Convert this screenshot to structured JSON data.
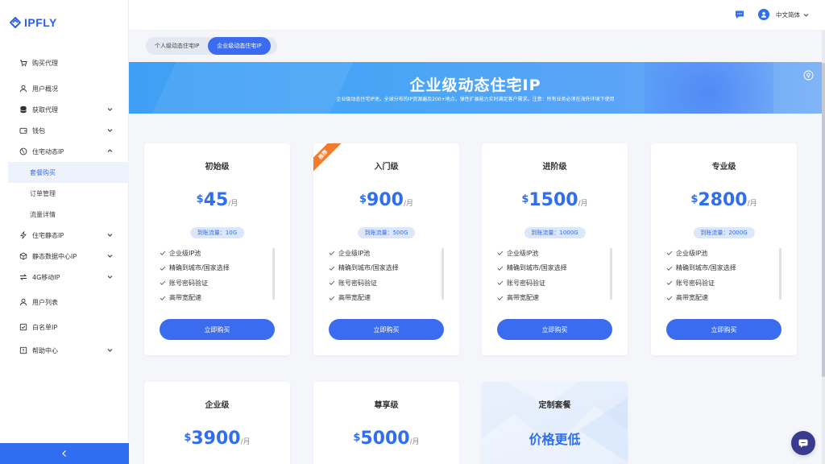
{
  "brand": {
    "name": "IPFLY",
    "color": "#2d5fe8"
  },
  "sidebar": {
    "items": [
      {
        "label": "购买代理",
        "icon": "cart-icon",
        "has_chevron": false
      },
      {
        "label": "用户概况",
        "icon": "user-icon",
        "has_chevron": false
      },
      {
        "label": "获取代理",
        "icon": "database-icon",
        "has_chevron": true
      },
      {
        "label": "钱包",
        "icon": "wallet-icon",
        "has_chevron": true
      },
      {
        "label": "住宅动态IP",
        "icon": "globe-icon",
        "has_chevron": true,
        "expanded": true,
        "children": [
          {
            "label": "套餐购买",
            "active": true
          },
          {
            "label": "订单管理",
            "active": false
          },
          {
            "label": "流量详情",
            "active": false
          }
        ]
      },
      {
        "label": "住宅静态IP",
        "icon": "bolt-icon",
        "has_chevron": true
      },
      {
        "label": "静态数据中心IP",
        "icon": "cube-icon",
        "has_chevron": true
      },
      {
        "label": "4G移动IP",
        "icon": "swap-icon",
        "has_chevron": true
      },
      {
        "label": "用户列表",
        "icon": "user-list-icon",
        "has_chevron": false
      },
      {
        "label": "白名单IP",
        "icon": "shield-list-icon",
        "has_chevron": false
      },
      {
        "label": "帮助中心",
        "icon": "help-icon",
        "has_chevron": true
      }
    ],
    "collapse_icon": "chevron-left-icon"
  },
  "topbar": {
    "language": "中文简体",
    "message_icon": "message-icon",
    "avatar_icon": "avatar-icon"
  },
  "tabs": [
    {
      "label": "个人级动态住宅IP",
      "active": false
    },
    {
      "label": "企业级动态住宅IP",
      "active": true
    }
  ],
  "banner": {
    "title": "企业级动态住宅IP",
    "subtitle": "企业级动态住宅IP池，全球分布的IP资源遍及200+地点，弹性扩展能力实时满足客户需求。注意：所有业务必须在海外环境下使用"
  },
  "plans": [
    {
      "name": "初始级",
      "currency": "$",
      "price": "45",
      "unit": "/月",
      "traffic": "到账流量：10G",
      "features": [
        "企业级IP池",
        "精确到城市/国家选择",
        "账号密码验证",
        "高带宽配速"
      ],
      "button": "立即购买",
      "badge": ""
    },
    {
      "name": "入门级",
      "currency": "$",
      "price": "900",
      "unit": "/月",
      "traffic": "到账流量：500G",
      "features": [
        "企业级IP池",
        "精确到城市/国家选择",
        "账号密码验证",
        "高带宽配速"
      ],
      "button": "立即购买",
      "badge": "推荐"
    },
    {
      "name": "进阶级",
      "currency": "$",
      "price": "1500",
      "unit": "/月",
      "traffic": "到账流量：1000G",
      "features": [
        "企业级IP池",
        "精确到城市/国家选择",
        "账号密码验证",
        "高带宽配速"
      ],
      "button": "立即购买",
      "badge": ""
    },
    {
      "name": "专业级",
      "currency": "$",
      "price": "2800",
      "unit": "/月",
      "traffic": "到账流量：2000G",
      "features": [
        "企业级IP池",
        "精确到城市/国家选择",
        "账号密码验证",
        "高带宽配速"
      ],
      "button": "立即购买",
      "badge": ""
    },
    {
      "name": "企业级",
      "currency": "$",
      "price": "3900",
      "unit": "/月"
    },
    {
      "name": "尊享级",
      "currency": "$",
      "price": "5000",
      "unit": "/月"
    }
  ],
  "custom_plan": {
    "name": "定制套餐",
    "headline": "价格更低"
  },
  "colors": {
    "primary": "#3b6cf0",
    "badge": "#f27c2c",
    "banner": "#4aa5f6",
    "fab": "#3a3b8f"
  }
}
